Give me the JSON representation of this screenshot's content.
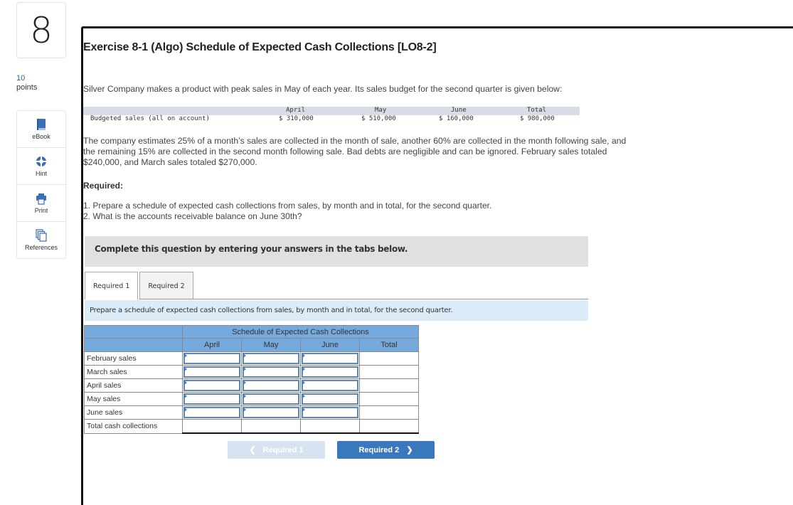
{
  "question": {
    "number": "8",
    "points_value": "10",
    "points_label": "points"
  },
  "tools": [
    {
      "label": "eBook",
      "icon": "book-icon"
    },
    {
      "label": "Hint",
      "icon": "lifebuoy-icon"
    },
    {
      "label": "Print",
      "icon": "printer-icon"
    },
    {
      "label": "References",
      "icon": "documents-icon"
    }
  ],
  "exercise": {
    "title": "Exercise 8-1 (Algo) Schedule of Expected Cash Collections [LO8-2]",
    "intro": "Silver Company makes a product with peak sales in May of each year. Its sales budget for the second quarter is given below:",
    "budget": {
      "row_label": "Budgeted sales (all on account)",
      "columns": [
        "April",
        "May",
        "June",
        "Total"
      ],
      "values": [
        "$ 310,000",
        "$ 510,000",
        "$ 160,000",
        "$ 980,000"
      ]
    },
    "estimate_text": "The company estimates 25% of a month’s sales are collected in the month of sale, another 60% are collected in the month following sale, and the remaining 15% are collected in the second month following sale. Bad debts are negligible and can be ignored. February sales totaled $240,000, and March sales totaled $270,000.",
    "required_heading": "Required:",
    "required_items": [
      "1. Prepare a schedule of expected cash collections from sales, by month and in total, for the second quarter.",
      "2. What is the accounts receivable balance on June 30th?"
    ]
  },
  "banner": "Complete this question by entering your answers in the tabs below.",
  "tabs": [
    {
      "label": "Required 1",
      "active": true
    },
    {
      "label": "Required 2",
      "active": false
    }
  ],
  "instruction": "Prepare a schedule of expected cash collections from sales, by month and in total, for the second quarter.",
  "schedule": {
    "title": "Schedule of Expected Cash Collections",
    "columns": [
      "April",
      "May",
      "June",
      "Total"
    ],
    "rows": [
      {
        "label": "February sales",
        "values": [
          "",
          "",
          "",
          ""
        ]
      },
      {
        "label": "March sales",
        "values": [
          "",
          "",
          "",
          ""
        ]
      },
      {
        "label": "April sales",
        "values": [
          "",
          "",
          "",
          ""
        ]
      },
      {
        "label": "May sales",
        "values": [
          "",
          "",
          "",
          ""
        ]
      },
      {
        "label": "June sales",
        "values": [
          "",
          "",
          "",
          ""
        ]
      }
    ],
    "total_row_label": "Total cash collections"
  },
  "navigation": {
    "prev_label": "Required 1",
    "next_label": "Required 2",
    "prev_icon": "chevron-left-icon",
    "next_icon": "chevron-right-icon"
  }
}
